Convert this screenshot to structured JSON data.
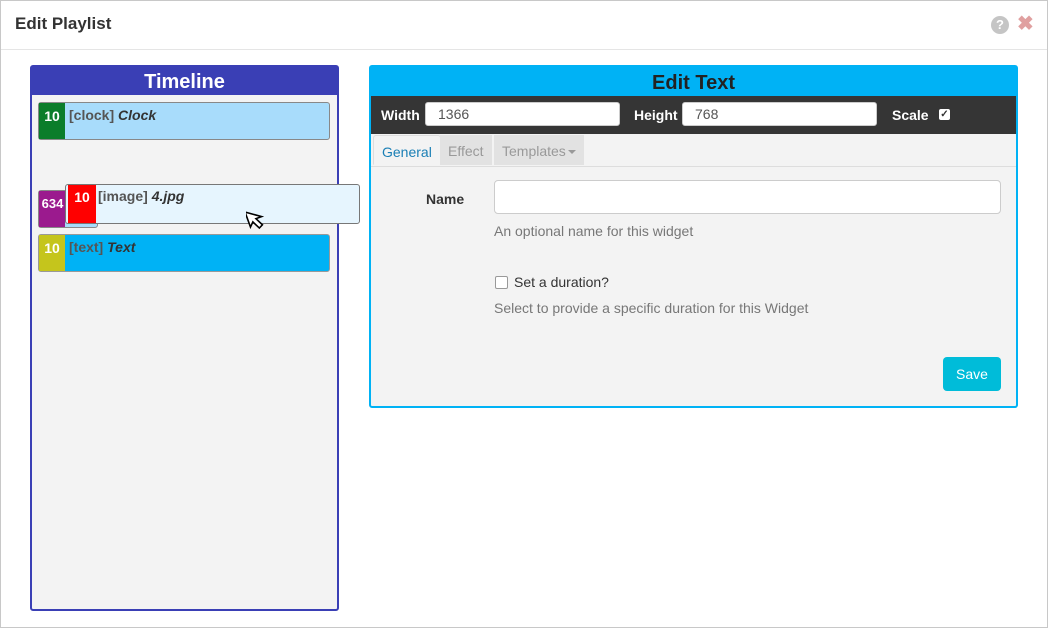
{
  "modal": {
    "title": "Edit Playlist",
    "help_glyph": "?",
    "close_glyph": "✖"
  },
  "timeline": {
    "title": "Timeline",
    "widgets": [
      {
        "duration": "10",
        "type": "[clock]",
        "name": "Clock",
        "color": "#0b7d2a"
      },
      {
        "duration": "634",
        "color": "#9b1a8e"
      },
      {
        "duration": "10",
        "type": "[text]",
        "name": "Text",
        "color": "#c5c51c"
      }
    ],
    "dragging": {
      "duration": "10",
      "type": "[image]",
      "name": "4.jpg",
      "color": "#ff0000"
    }
  },
  "edit": {
    "title": "Edit Text",
    "width_label": "Width",
    "width_value": "1366",
    "height_label": "Height",
    "height_value": "768",
    "scale_label": "Scale",
    "scale_checked": true,
    "tabs": [
      "General",
      "Effect",
      "Templates"
    ],
    "active_tab": "General",
    "name_label": "Name",
    "name_value": "",
    "name_help": "An optional name for this widget",
    "duration_label": "Set a duration?",
    "duration_help": "Select to provide a specific duration for this Widget",
    "save_label": "Save"
  },
  "colors": {
    "timeline": "#3a3fb5",
    "edit": "#00b2f5",
    "save": "#00bcd9"
  }
}
